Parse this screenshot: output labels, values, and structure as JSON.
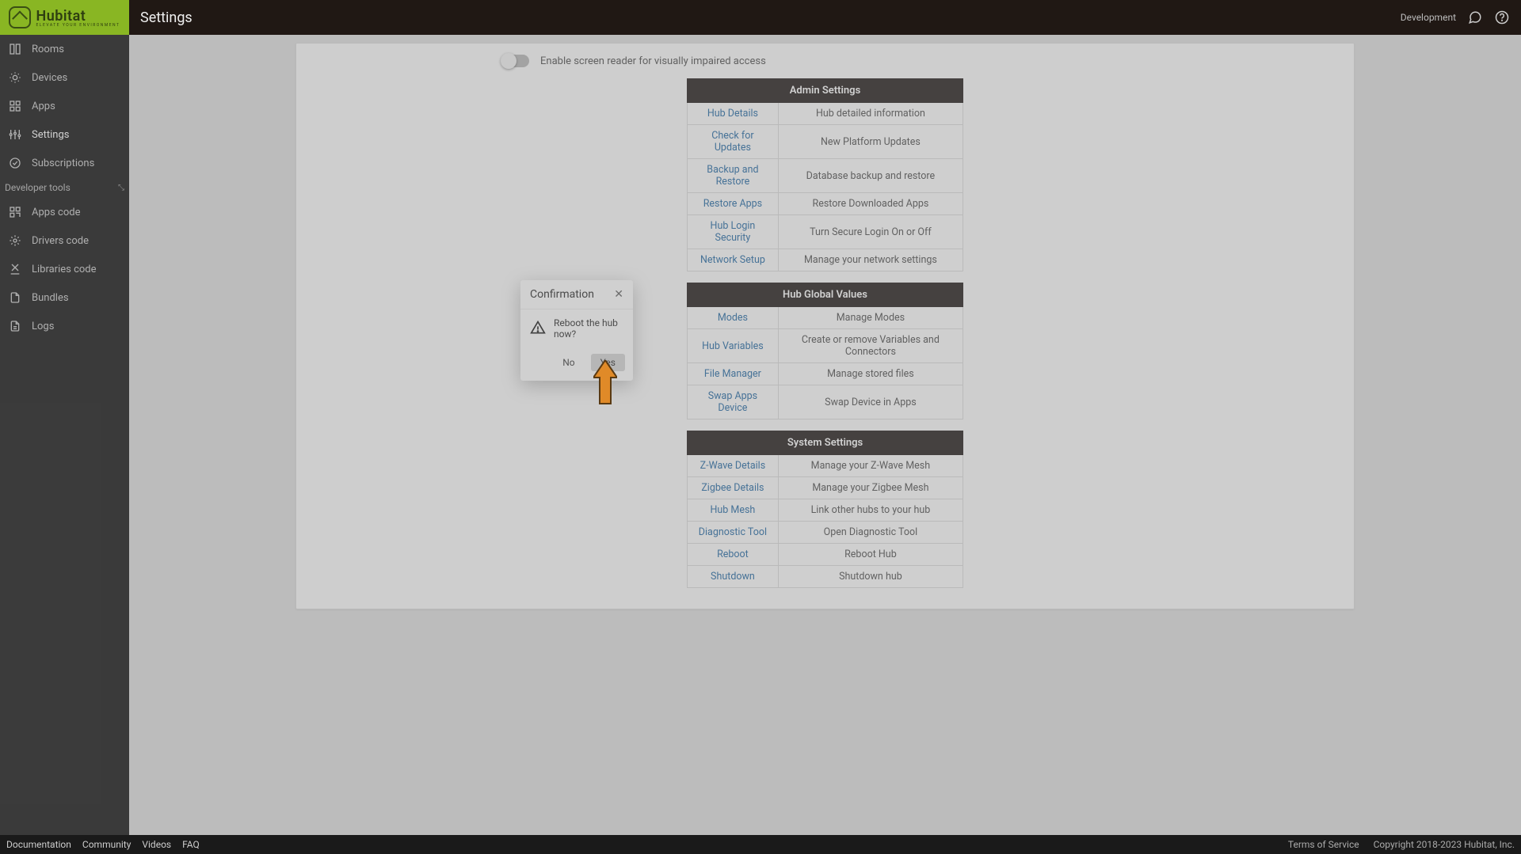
{
  "brand": {
    "name": "Hubitat",
    "tagline": "ELEVATE YOUR ENVIRONMENT"
  },
  "header": {
    "title": "Settings",
    "env_label": "Development"
  },
  "sidebar": {
    "items": [
      {
        "label": "Rooms"
      },
      {
        "label": "Devices"
      },
      {
        "label": "Apps"
      },
      {
        "label": "Settings"
      },
      {
        "label": "Subscriptions"
      }
    ],
    "dev_group_label": "Developer tools",
    "dev_items": [
      {
        "label": "Apps code"
      },
      {
        "label": "Drivers code"
      },
      {
        "label": "Libraries code"
      },
      {
        "label": "Bundles"
      },
      {
        "label": "Logs"
      }
    ]
  },
  "toggle": {
    "label": "Enable screen reader for visually impaired access"
  },
  "sections": [
    {
      "title": "Admin Settings",
      "rows": [
        {
          "link": "Hub Details",
          "desc": "Hub detailed information"
        },
        {
          "link": "Check for Updates",
          "desc": "New Platform Updates"
        },
        {
          "link": "Backup and Restore",
          "desc": "Database backup and restore"
        },
        {
          "link": "Restore Apps",
          "desc": "Restore Downloaded Apps"
        },
        {
          "link": "Hub Login Security",
          "desc": "Turn Secure Login On or Off"
        },
        {
          "link": "Network Setup",
          "desc": "Manage your network settings"
        }
      ]
    },
    {
      "title": "Hub Global Values",
      "rows": [
        {
          "link": "Modes",
          "desc": "Manage Modes"
        },
        {
          "link": "Hub Variables",
          "desc": "Create or remove Variables and Connectors"
        },
        {
          "link": "File Manager",
          "desc": "Manage stored files"
        },
        {
          "link": "Swap Apps Device",
          "desc": "Swap Device in Apps"
        }
      ]
    },
    {
      "title": "System Settings",
      "rows": [
        {
          "link": "Z-Wave Details",
          "desc": "Manage your Z-Wave Mesh"
        },
        {
          "link": "Zigbee Details",
          "desc": "Manage your Zigbee Mesh"
        },
        {
          "link": "Hub Mesh",
          "desc": "Link other hubs to your hub"
        },
        {
          "link": "Diagnostic Tool",
          "desc": "Open Diagnostic Tool"
        },
        {
          "link": "Reboot",
          "desc": "Reboot Hub"
        },
        {
          "link": "Shutdown",
          "desc": "Shutdown hub"
        }
      ]
    }
  ],
  "modal": {
    "title": "Confirmation",
    "message": "Reboot the hub now?",
    "no_label": "No",
    "yes_label": "Yes"
  },
  "footer": {
    "left": [
      "Documentation",
      "Community",
      "Videos",
      "FAQ"
    ],
    "right": [
      "Terms of Service",
      "Copyright 2018-2023 Hubitat, Inc."
    ]
  },
  "colors": {
    "brand_green": "#89b623",
    "link": "#2c6fa8",
    "header_dark": "#201814"
  }
}
